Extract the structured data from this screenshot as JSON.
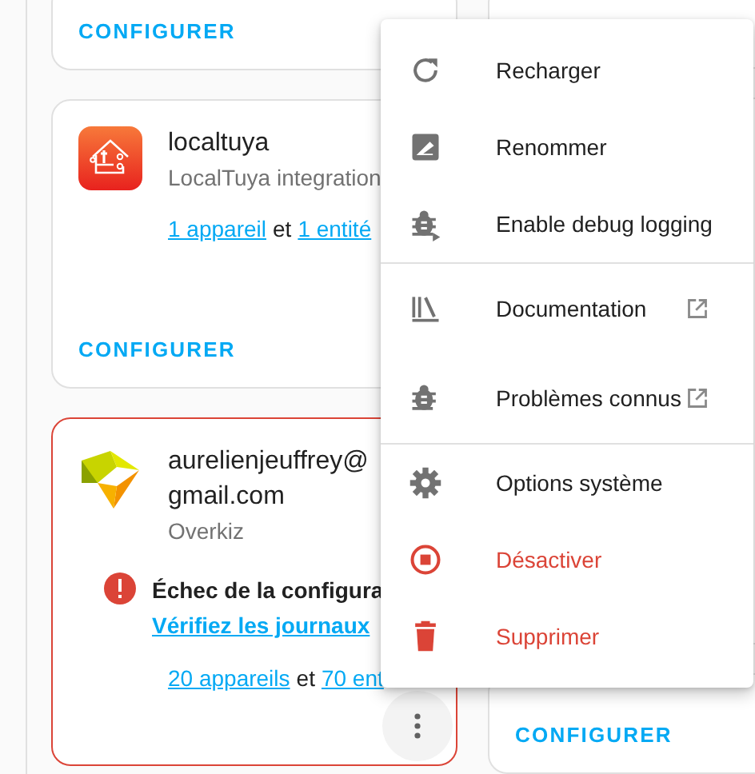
{
  "left_cards": [
    {
      "kind": "footer",
      "button": "CONFIGURER"
    },
    {
      "kind": "integration",
      "failed": false,
      "title_lines": [
        "localtuya"
      ],
      "subtitle": "LocalTuya integration",
      "devices": "1 appareil",
      "joiner": "et",
      "entities": "1 entité",
      "button": "CONFIGURER"
    },
    {
      "kind": "integration",
      "failed": true,
      "title_lines": [
        "aurelienjeuffrey@",
        "gmail.com"
      ],
      "subtitle": "Overkiz",
      "error": {
        "message": "Échec de la configura",
        "link": "Vérifiez les journaux"
      },
      "devices": "20 appareils",
      "joiner": "et",
      "entities": "70 ent",
      "more_button": true
    }
  ],
  "right_cards": [
    {
      "kind": "footer"
    },
    {
      "kind": "blank"
    },
    {
      "kind": "footer",
      "button": "CONFIGURER"
    }
  ],
  "menu": {
    "items": [
      {
        "label": "Recharger",
        "danger": false,
        "external": false,
        "divider_after": false
      },
      {
        "label": "Renommer",
        "danger": false,
        "external": false,
        "divider_after": false
      },
      {
        "label": "Enable debug logging",
        "danger": false,
        "external": false,
        "divider_after": true
      },
      {
        "label": "Documentation",
        "danger": false,
        "external": true,
        "divider_after": false
      },
      {
        "label": "Problèmes connus",
        "danger": false,
        "external": true,
        "divider_after": true
      },
      {
        "label": "Options système",
        "danger": false,
        "external": false,
        "divider_after": false
      },
      {
        "label": "Désactiver",
        "danger": true,
        "external": false,
        "divider_after": false
      },
      {
        "label": "Supprimer",
        "danger": true,
        "external": false,
        "divider_after": false
      }
    ]
  }
}
